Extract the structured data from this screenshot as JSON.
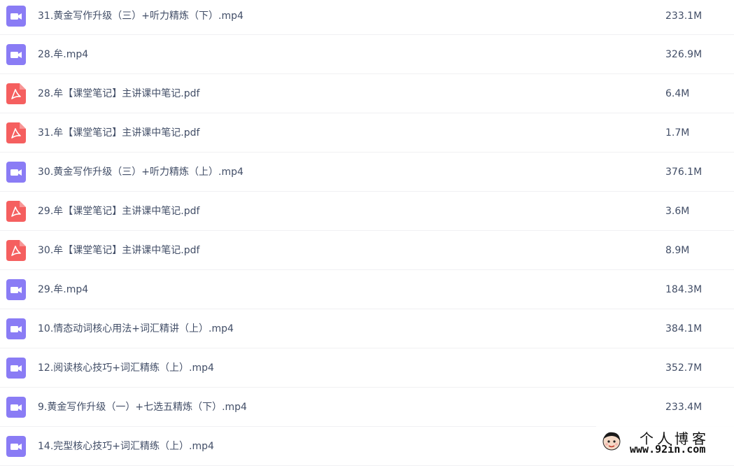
{
  "files": [
    {
      "name": "31.黄金写作升级（三）+听力精炼（下）.mp4",
      "size": "233.1M",
      "type": "video"
    },
    {
      "name": "28.牟.mp4",
      "size": "326.9M",
      "type": "video"
    },
    {
      "name": "28.牟【课堂笔记】主讲课中笔记.pdf",
      "size": "6.4M",
      "type": "pdf"
    },
    {
      "name": "31.牟【课堂笔记】主讲课中笔记.pdf",
      "size": "1.7M",
      "type": "pdf"
    },
    {
      "name": "30.黄金写作升级（三）+听力精炼（上）.mp4",
      "size": "376.1M",
      "type": "video"
    },
    {
      "name": "29.牟【课堂笔记】主讲课中笔记.pdf",
      "size": "3.6M",
      "type": "pdf"
    },
    {
      "name": "30.牟【课堂笔记】主讲课中笔记.pdf",
      "size": "8.9M",
      "type": "pdf"
    },
    {
      "name": "29.牟.mp4",
      "size": "184.3M",
      "type": "video"
    },
    {
      "name": "10.情态动词核心用法+词汇精讲（上）.mp4",
      "size": "384.1M",
      "type": "video"
    },
    {
      "name": "12.阅读核心技巧+词汇精练（上）.mp4",
      "size": "352.7M",
      "type": "video"
    },
    {
      "name": "9.黄金写作升级（一）+七选五精炼（下）.mp4",
      "size": "233.4M",
      "type": "video"
    },
    {
      "name": "14.完型核心技巧+词汇精练（上）.mp4",
      "size": "",
      "type": "video"
    }
  ],
  "icons": {
    "video": {
      "name": "video-file-icon",
      "color": "#8a7cf5"
    },
    "pdf": {
      "name": "pdf-file-icon",
      "color": "#f55f5f"
    }
  },
  "watermark": {
    "title": "个人博客",
    "url": "www.92in.com"
  }
}
